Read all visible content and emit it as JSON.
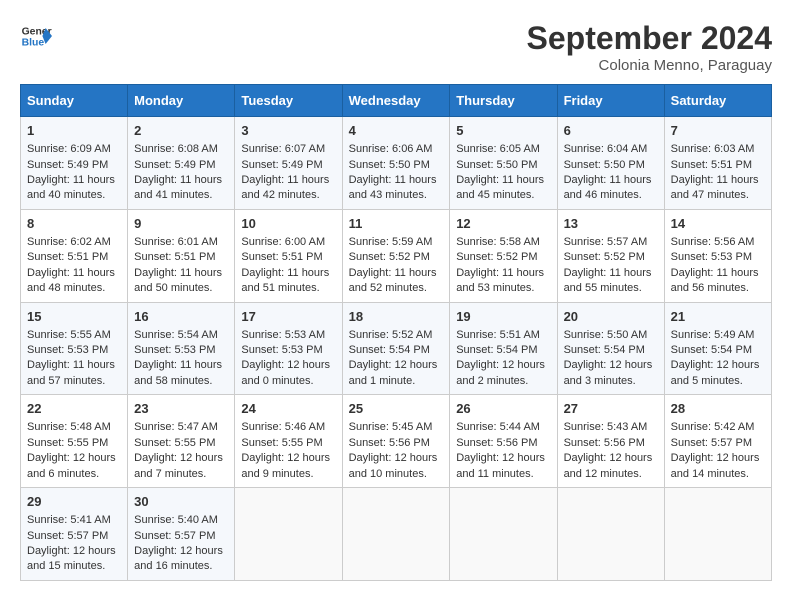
{
  "header": {
    "logo_line1": "General",
    "logo_line2": "Blue",
    "month_year": "September 2024",
    "location": "Colonia Menno, Paraguay"
  },
  "days_of_week": [
    "Sunday",
    "Monday",
    "Tuesday",
    "Wednesday",
    "Thursday",
    "Friday",
    "Saturday"
  ],
  "weeks": [
    [
      {
        "day": "1",
        "info": "Sunrise: 6:09 AM\nSunset: 5:49 PM\nDaylight: 11 hours and 40 minutes."
      },
      {
        "day": "2",
        "info": "Sunrise: 6:08 AM\nSunset: 5:49 PM\nDaylight: 11 hours and 41 minutes."
      },
      {
        "day": "3",
        "info": "Sunrise: 6:07 AM\nSunset: 5:49 PM\nDaylight: 11 hours and 42 minutes."
      },
      {
        "day": "4",
        "info": "Sunrise: 6:06 AM\nSunset: 5:50 PM\nDaylight: 11 hours and 43 minutes."
      },
      {
        "day": "5",
        "info": "Sunrise: 6:05 AM\nSunset: 5:50 PM\nDaylight: 11 hours and 45 minutes."
      },
      {
        "day": "6",
        "info": "Sunrise: 6:04 AM\nSunset: 5:50 PM\nDaylight: 11 hours and 46 minutes."
      },
      {
        "day": "7",
        "info": "Sunrise: 6:03 AM\nSunset: 5:51 PM\nDaylight: 11 hours and 47 minutes."
      }
    ],
    [
      {
        "day": "8",
        "info": "Sunrise: 6:02 AM\nSunset: 5:51 PM\nDaylight: 11 hours and 48 minutes."
      },
      {
        "day": "9",
        "info": "Sunrise: 6:01 AM\nSunset: 5:51 PM\nDaylight: 11 hours and 50 minutes."
      },
      {
        "day": "10",
        "info": "Sunrise: 6:00 AM\nSunset: 5:51 PM\nDaylight: 11 hours and 51 minutes."
      },
      {
        "day": "11",
        "info": "Sunrise: 5:59 AM\nSunset: 5:52 PM\nDaylight: 11 hours and 52 minutes."
      },
      {
        "day": "12",
        "info": "Sunrise: 5:58 AM\nSunset: 5:52 PM\nDaylight: 11 hours and 53 minutes."
      },
      {
        "day": "13",
        "info": "Sunrise: 5:57 AM\nSunset: 5:52 PM\nDaylight: 11 hours and 55 minutes."
      },
      {
        "day": "14",
        "info": "Sunrise: 5:56 AM\nSunset: 5:53 PM\nDaylight: 11 hours and 56 minutes."
      }
    ],
    [
      {
        "day": "15",
        "info": "Sunrise: 5:55 AM\nSunset: 5:53 PM\nDaylight: 11 hours and 57 minutes."
      },
      {
        "day": "16",
        "info": "Sunrise: 5:54 AM\nSunset: 5:53 PM\nDaylight: 11 hours and 58 minutes."
      },
      {
        "day": "17",
        "info": "Sunrise: 5:53 AM\nSunset: 5:53 PM\nDaylight: 12 hours and 0 minutes."
      },
      {
        "day": "18",
        "info": "Sunrise: 5:52 AM\nSunset: 5:54 PM\nDaylight: 12 hours and 1 minute."
      },
      {
        "day": "19",
        "info": "Sunrise: 5:51 AM\nSunset: 5:54 PM\nDaylight: 12 hours and 2 minutes."
      },
      {
        "day": "20",
        "info": "Sunrise: 5:50 AM\nSunset: 5:54 PM\nDaylight: 12 hours and 3 minutes."
      },
      {
        "day": "21",
        "info": "Sunrise: 5:49 AM\nSunset: 5:54 PM\nDaylight: 12 hours and 5 minutes."
      }
    ],
    [
      {
        "day": "22",
        "info": "Sunrise: 5:48 AM\nSunset: 5:55 PM\nDaylight: 12 hours and 6 minutes."
      },
      {
        "day": "23",
        "info": "Sunrise: 5:47 AM\nSunset: 5:55 PM\nDaylight: 12 hours and 7 minutes."
      },
      {
        "day": "24",
        "info": "Sunrise: 5:46 AM\nSunset: 5:55 PM\nDaylight: 12 hours and 9 minutes."
      },
      {
        "day": "25",
        "info": "Sunrise: 5:45 AM\nSunset: 5:56 PM\nDaylight: 12 hours and 10 minutes."
      },
      {
        "day": "26",
        "info": "Sunrise: 5:44 AM\nSunset: 5:56 PM\nDaylight: 12 hours and 11 minutes."
      },
      {
        "day": "27",
        "info": "Sunrise: 5:43 AM\nSunset: 5:56 PM\nDaylight: 12 hours and 12 minutes."
      },
      {
        "day": "28",
        "info": "Sunrise: 5:42 AM\nSunset: 5:57 PM\nDaylight: 12 hours and 14 minutes."
      }
    ],
    [
      {
        "day": "29",
        "info": "Sunrise: 5:41 AM\nSunset: 5:57 PM\nDaylight: 12 hours and 15 minutes."
      },
      {
        "day": "30",
        "info": "Sunrise: 5:40 AM\nSunset: 5:57 PM\nDaylight: 12 hours and 16 minutes."
      },
      {
        "day": "",
        "info": ""
      },
      {
        "day": "",
        "info": ""
      },
      {
        "day": "",
        "info": ""
      },
      {
        "day": "",
        "info": ""
      },
      {
        "day": "",
        "info": ""
      }
    ]
  ]
}
